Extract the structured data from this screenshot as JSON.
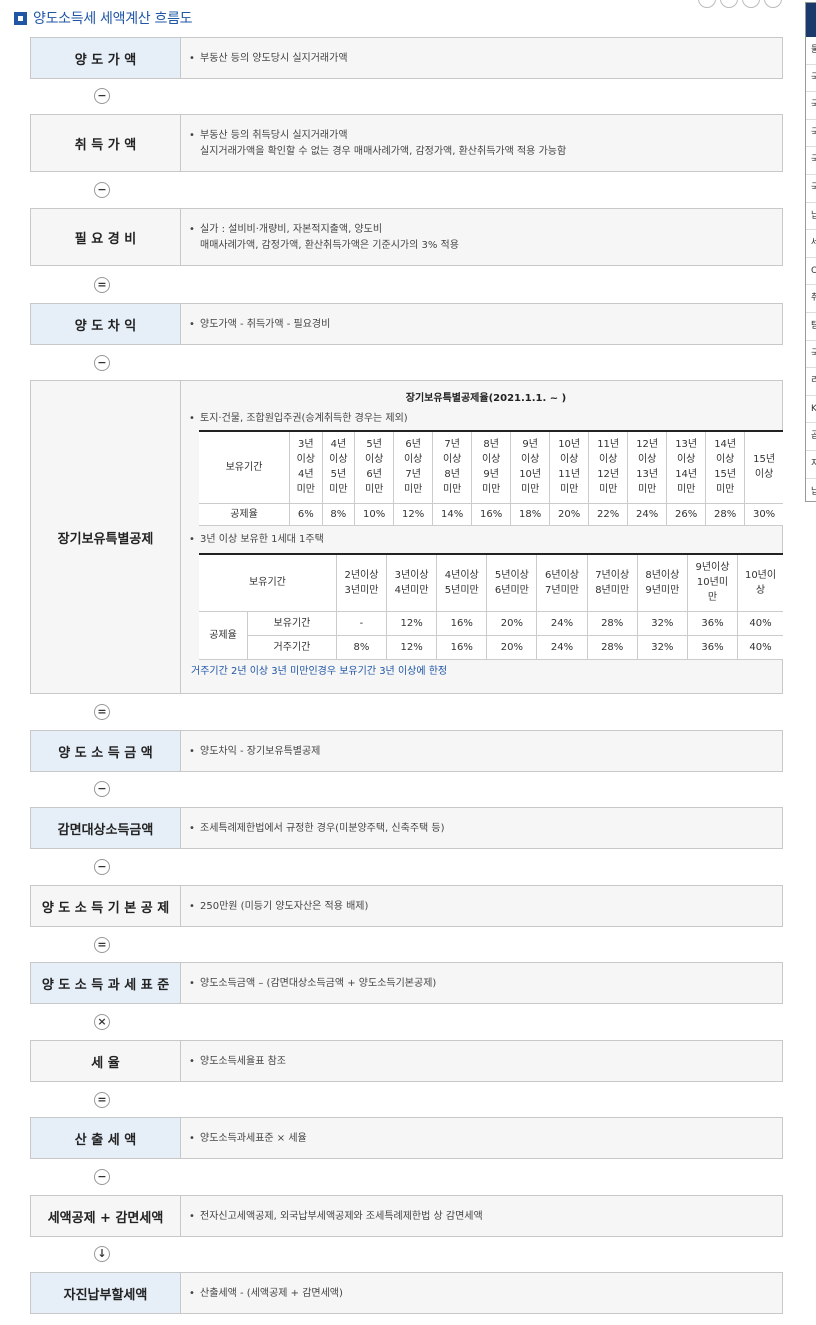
{
  "heading": "양도소득세 세액계산 흐름도",
  "side_rows": [
    "물",
    "국",
    "국",
    "국",
    "국",
    "국",
    "납",
    "세",
    "O",
    "취",
    "탐",
    "국",
    "리",
    "K",
    "곱",
    "지",
    "납"
  ],
  "rows": {
    "r1": {
      "label": "양 도 가 액",
      "lines": [
        "부동산 등의 양도당시 실지거래가액"
      ]
    },
    "r2": {
      "label": "취 득 가 액",
      "lines": [
        "부동산 등의 취득당시 실지거래가액"
      ],
      "sub": "실지거래가액을 확인할 수 없는 경우 매매사례가액, 감정가액, 환산취득가액 적용 가능함"
    },
    "r3": {
      "label": "필 요 경 비",
      "lines": [
        "실가 : 설비비·개량비, 자본적지출액, 양도비"
      ],
      "sub": "매매사례가액, 감정가액, 환산취득가액은 기준시가의 3% 적용"
    },
    "r4": {
      "label": "양 도 차 익",
      "lines": [
        "양도가액 - 취득가액 - 필요경비"
      ]
    },
    "r5": {
      "label": "장기보유특별공제"
    },
    "r6": {
      "label": "양 도 소 득 금 액",
      "lines": [
        "양도차익 - 장기보유특별공제"
      ]
    },
    "r7": {
      "label": "감면대상소득금액",
      "lines": [
        "조세특례제한법에서 규정한 경우(미분양주택, 신축주택 등)"
      ]
    },
    "r8": {
      "label": "양 도 소 득 기 본 공 제",
      "lines": [
        "250만원 (미등기 양도자산은 적용 배제)"
      ]
    },
    "r9": {
      "label": "양 도 소 득 과 세 표 준",
      "lines": [
        "양도소득금액 – (감면대상소득금액 + 양도소득기본공제)"
      ]
    },
    "r10": {
      "label": "세 율",
      "lines": [
        "양도소득세율표 참조"
      ]
    },
    "r11": {
      "label": "산 출 세 액",
      "lines": [
        "양도소득과세표준 × 세율"
      ]
    },
    "r12": {
      "label": "세액공제 + 감면세액",
      "lines": [
        "전자신고세액공제, 외국납부세액공제와 조세특례제한법 상 감면세액"
      ]
    },
    "r13": {
      "label": "자진납부할세액",
      "lines": [
        "산출세액 - (세액공제 + 감면세액)"
      ]
    }
  },
  "bullet": "•",
  "operators": [
    "−",
    "−",
    "=",
    "−",
    "=",
    "−",
    "−",
    "=",
    "×",
    "=",
    "−",
    "↓"
  ],
  "ltsd": {
    "title": "장기보유특별공제율(2021.1.1. ~ )",
    "general_caption": "토지·건물, 조합원입주권(승계취득한 경우는 제외)",
    "general_row_label": "보유기간",
    "general_periods": [
      [
        "3년",
        "이상",
        "4년",
        "미만"
      ],
      [
        "4년",
        "이상",
        "5년",
        "미만"
      ],
      [
        "5년",
        "이상",
        "6년",
        "미만"
      ],
      [
        "6년",
        "이상",
        "7년",
        "미만"
      ],
      [
        "7년",
        "이상",
        "8년",
        "미만"
      ],
      [
        "8년",
        "이상",
        "9년",
        "미만"
      ],
      [
        "9년",
        "이상",
        "10년",
        "미만"
      ],
      [
        "10년",
        "이상",
        "11년",
        "미만"
      ],
      [
        "11년",
        "이상",
        "12년",
        "미만"
      ],
      [
        "12년",
        "이상",
        "13년",
        "미만"
      ],
      [
        "13년",
        "이상",
        "14년",
        "미만"
      ],
      [
        "14년",
        "이상",
        "15년",
        "미만"
      ],
      [
        "15년",
        "이상"
      ]
    ],
    "general_rate_label": "공제율",
    "general_rates": [
      "6%",
      "8%",
      "10%",
      "12%",
      "14%",
      "16%",
      "18%",
      "20%",
      "22%",
      "24%",
      "26%",
      "28%",
      "30%"
    ],
    "house_caption": "3년 이상 보유한 1세대 1주택",
    "house_row_label": "보유기간",
    "house_periods": [
      [
        "2년이상",
        "3년미만"
      ],
      [
        "3년이상",
        "4년미만"
      ],
      [
        "4년이상",
        "5년미만"
      ],
      [
        "5년이상",
        "6년미만"
      ],
      [
        "6년이상",
        "7년미만"
      ],
      [
        "7년이상",
        "8년미만"
      ],
      [
        "8년이상",
        "9년미만"
      ],
      [
        "9년이상",
        "10년미",
        "만"
      ],
      [
        "10년이",
        "상"
      ]
    ],
    "house_rate_label": "공제율",
    "house_sub1": "보유기간",
    "house_sub2": "거주기간",
    "house_hold_rates": [
      "-",
      "12%",
      "16%",
      "20%",
      "24%",
      "28%",
      "32%",
      "36%",
      "40%"
    ],
    "house_live_rates": [
      "8%",
      "12%",
      "16%",
      "20%",
      "24%",
      "28%",
      "32%",
      "36%",
      "40%"
    ],
    "note": "거주기간 2년 이상 3년 미만인경우 보유기간 3년 이상에 한정"
  }
}
